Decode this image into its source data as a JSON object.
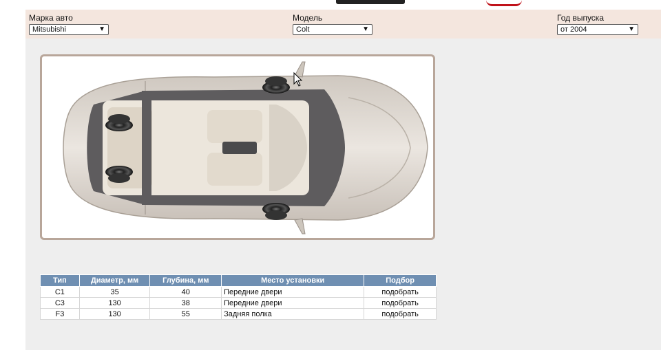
{
  "filters": {
    "make": {
      "label": "Марка авто",
      "value": "Mitsubishi"
    },
    "model": {
      "label": "Модель",
      "value": "Colt"
    },
    "year": {
      "label": "Год выпуска",
      "value": "от 2004"
    }
  },
  "diagram": {
    "speaker_positions": [
      "front-right-door",
      "rear-left",
      "rear-right",
      "front-left-door"
    ]
  },
  "table": {
    "headers": {
      "type": "Тип",
      "diameter": "Диаметр, мм",
      "depth": "Глубина, мм",
      "place": "Место установки",
      "select": "Подбор"
    },
    "rows": [
      {
        "type": "C1",
        "diameter": "35",
        "depth": "40",
        "place": "Передние двери",
        "select": "подобрать"
      },
      {
        "type": "C3",
        "diameter": "130",
        "depth": "38",
        "place": "Передние двери",
        "select": "подобрать"
      },
      {
        "type": "F3",
        "diameter": "130",
        "depth": "55",
        "place": "Задняя полка",
        "select": "подобрать"
      }
    ]
  }
}
